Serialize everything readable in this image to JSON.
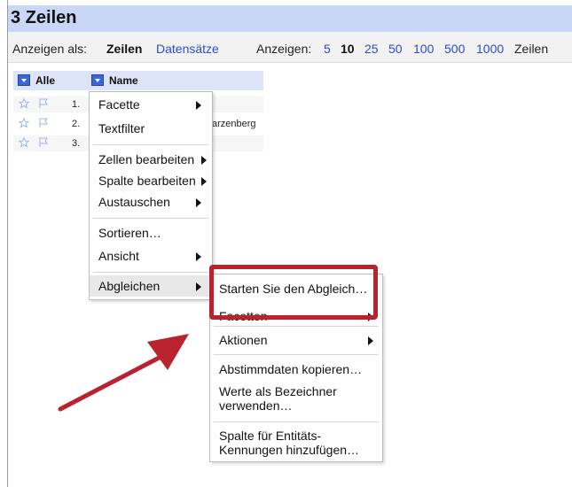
{
  "header": {
    "title": "3 Zeilen"
  },
  "viewbar": {
    "show_as_label": "Anzeigen als:",
    "rows_option": "Zeilen",
    "records_option": "Datensätze",
    "show_label": "Anzeigen:",
    "page_sizes": [
      "5",
      "10",
      "25",
      "50",
      "100",
      "500",
      "1000"
    ],
    "selected_page_size": "10",
    "rows_suffix": "Zeilen"
  },
  "grid": {
    "columns": [
      "Alle",
      "Name"
    ],
    "rows": [
      {
        "num": "1.",
        "value": ""
      },
      {
        "num": "2.",
        "value": "arzenberg"
      },
      {
        "num": "3.",
        "value": ""
      }
    ]
  },
  "column_menu": {
    "items": [
      {
        "label": "Facette",
        "submenu": true
      },
      {
        "label": "Textfilter",
        "submenu": false
      },
      {
        "label": "Zellen bearbeiten",
        "submenu": true
      },
      {
        "label": "Spalte bearbeiten",
        "submenu": true
      },
      {
        "label": "Austauschen",
        "submenu": true
      },
      {
        "label": "Sortieren…",
        "submenu": false
      },
      {
        "label": "Ansicht",
        "submenu": true
      },
      {
        "label": "Abgleichen",
        "submenu": true
      }
    ]
  },
  "reconcile_menu": {
    "items": [
      {
        "label": "Starten Sie den Abgleich…",
        "submenu": false
      },
      {
        "label": "Facetten",
        "submenu": true
      },
      {
        "label": "Aktionen",
        "submenu": true
      },
      {
        "label": "Abstimmdaten kopieren…",
        "submenu": false
      },
      {
        "label": "Werte als Bezeichner verwenden…",
        "submenu": false
      },
      {
        "label": "Spalte für Entitäts-Kennungen hinzufügen…",
        "submenu": false
      }
    ]
  },
  "colors": {
    "header_bg": "#c9d6f5",
    "link": "#2a4ad0",
    "highlight_box": "#b8232e",
    "annotation_arrow": "#b8232e"
  }
}
